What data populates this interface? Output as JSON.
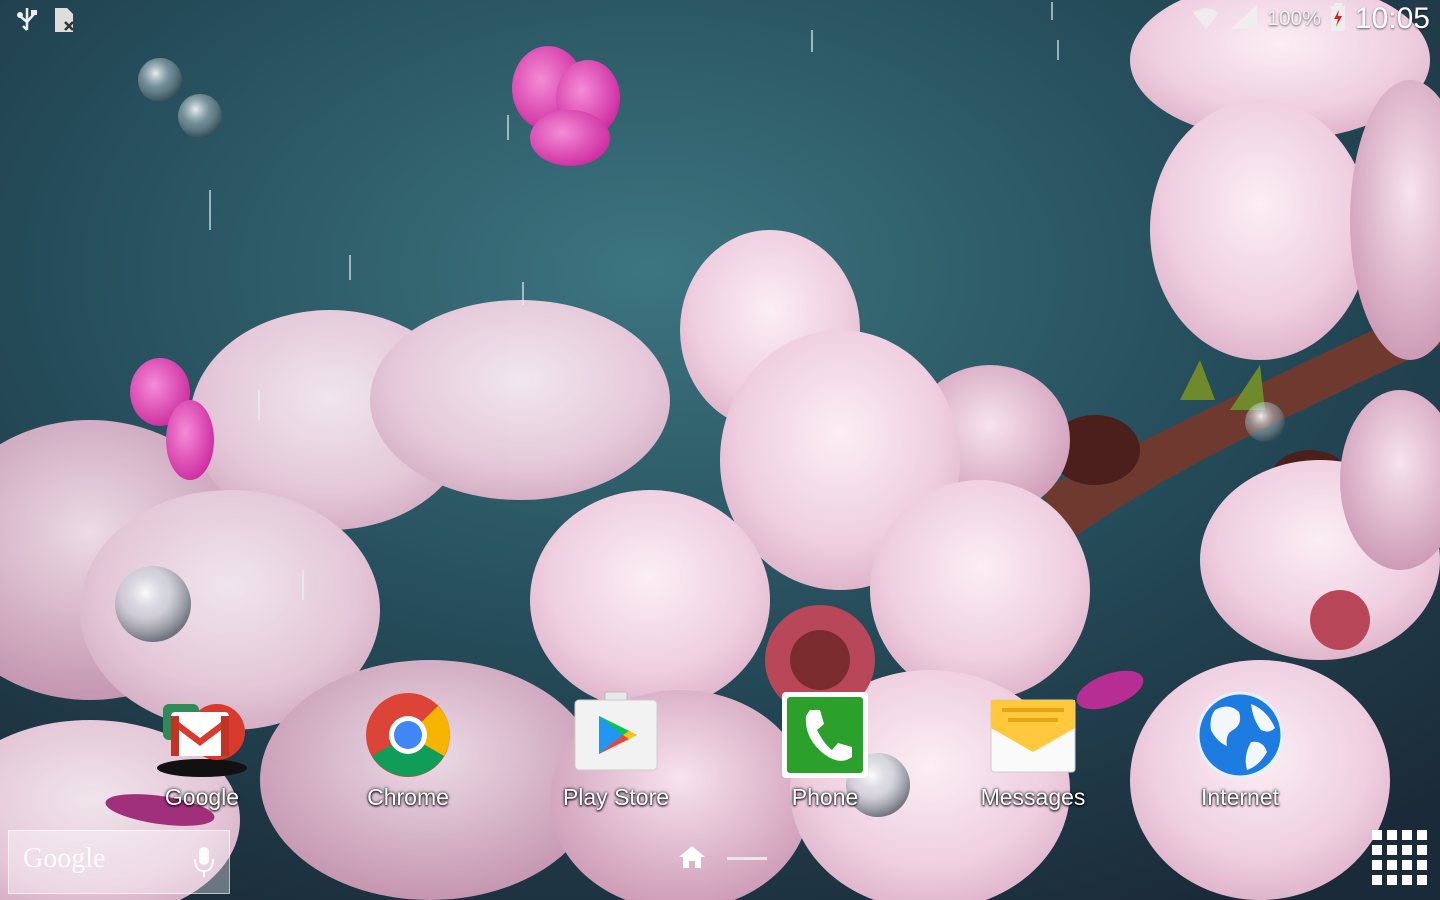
{
  "status_bar": {
    "left_icons": [
      "usb-icon",
      "sim-card-icon"
    ],
    "battery_percent": "100%",
    "time": "10:05",
    "right_icons": [
      "wifi-icon",
      "signal-icon",
      "battery-charging-icon"
    ]
  },
  "search_widget": {
    "placeholder": "Google",
    "icon": "microphone-icon"
  },
  "dock": {
    "apps": [
      {
        "label": "Google",
        "icon": "google-folder-icon"
      },
      {
        "label": "Chrome",
        "icon": "chrome-icon"
      },
      {
        "label": "Play Store",
        "icon": "play-store-icon"
      },
      {
        "label": "Phone",
        "icon": "phone-icon"
      },
      {
        "label": "Messages",
        "icon": "messages-icon"
      },
      {
        "label": "Internet",
        "icon": "globe-icon"
      }
    ]
  },
  "navigation": {
    "home_icon": "home-icon",
    "drawer_icon": "app-drawer-icon"
  },
  "colors": {
    "blossom": "#f3d4e2",
    "petal_magenta": "#e94fba",
    "background_teal": "#2a5664",
    "branch": "#6e3a30",
    "gmail_red": "#d93a2e",
    "phone_green": "#2ba02b"
  }
}
